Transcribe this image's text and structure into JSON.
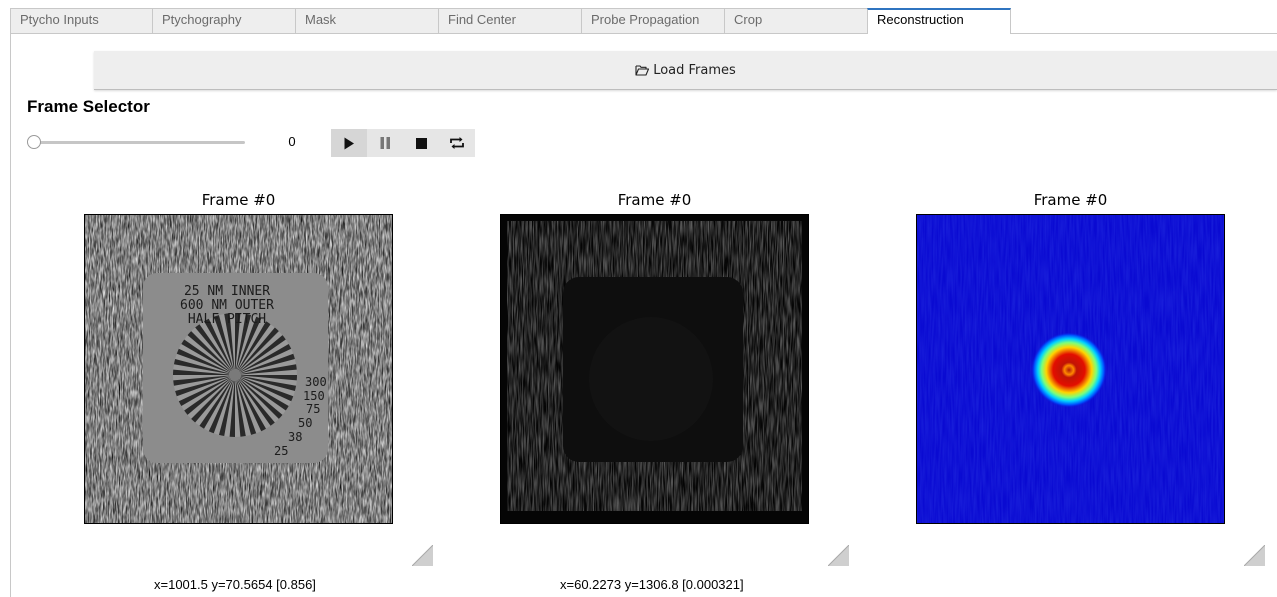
{
  "tabs": [
    {
      "label": "Ptycho Inputs"
    },
    {
      "label": "Ptychography"
    },
    {
      "label": "Mask"
    },
    {
      "label": "Find Center"
    },
    {
      "label": "Probe Propagation"
    },
    {
      "label": "Crop"
    },
    {
      "label": "Reconstruction",
      "active": true
    }
  ],
  "load_button": {
    "label": "Load Frames",
    "icon": "folder-open-icon"
  },
  "frame_selector": {
    "title": "Frame Selector",
    "slider_value": "0",
    "slider_fraction": 0,
    "controls": [
      "play-icon",
      "pause-icon",
      "stop-icon",
      "repeat-icon"
    ]
  },
  "panels": [
    {
      "title": "Frame #0",
      "image": "reconstruction-amplitude",
      "colormap": "gray",
      "sample_text": [
        "25 NM INNER",
        "600 NM OUTER",
        "HALF PITCH"
      ],
      "scale_labels": [
        "300",
        "150",
        "75",
        "50",
        "38",
        "25"
      ],
      "coords": "x=1001.5 y=70.5654 [0.856]"
    },
    {
      "title": "Frame #0",
      "image": "reconstruction-phase",
      "colormap": "gray",
      "coords": "x=60.2273 y=1306.8 [0.000321]"
    },
    {
      "title": "Frame #0",
      "image": "probe-intensity",
      "colormap": "jet",
      "coords": ""
    }
  ],
  "colors": {
    "tab_active_border": "#2f74c0",
    "probe_background": "#0a0ad2"
  }
}
